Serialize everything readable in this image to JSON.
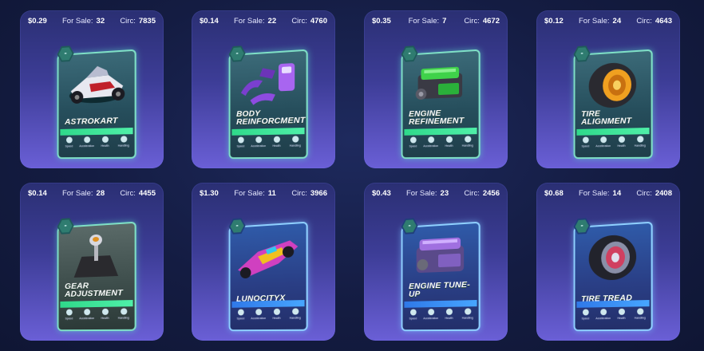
{
  "stat_labels": {
    "for_sale": "For Sale:",
    "circ": "Circ:"
  },
  "attribute_labels": [
    "Speed",
    "Acceleration",
    "Health",
    "Handling"
  ],
  "cards": [
    {
      "price": "$0.29",
      "for_sale": "32",
      "circ": "7835",
      "name": "ASTROKART",
      "rarity_badge": "-"
    },
    {
      "price": "$0.14",
      "for_sale": "22",
      "circ": "4760",
      "name": "BODY REINFORCMENT",
      "rarity_badge": "-"
    },
    {
      "price": "$0.35",
      "for_sale": "7",
      "circ": "4672",
      "name": "ENGINE REFINEMENT",
      "rarity_badge": "-"
    },
    {
      "price": "$0.12",
      "for_sale": "24",
      "circ": "4643",
      "name": "TIRE ALIGNMENT",
      "rarity_badge": "-"
    },
    {
      "price": "$0.14",
      "for_sale": "28",
      "circ": "4455",
      "name": "GEAR ADJUSTMENT",
      "rarity_badge": "-"
    },
    {
      "price": "$1.30",
      "for_sale": "11",
      "circ": "3966",
      "name": "LUNOCITYX",
      "rarity_badge": "-"
    },
    {
      "price": "$0.43",
      "for_sale": "23",
      "circ": "2456",
      "name": "ENGINE TUNE-UP",
      "rarity_badge": "-"
    },
    {
      "price": "$0.68",
      "for_sale": "14",
      "circ": "2408",
      "name": "TIRE TREAD",
      "rarity_badge": "-"
    }
  ],
  "colors": {
    "background": "#141c42",
    "card_top": "#2a2f73",
    "card_bottom": "#6a5fd6",
    "green_band": "#2fd88a",
    "blue_band": "#2f78e8"
  }
}
